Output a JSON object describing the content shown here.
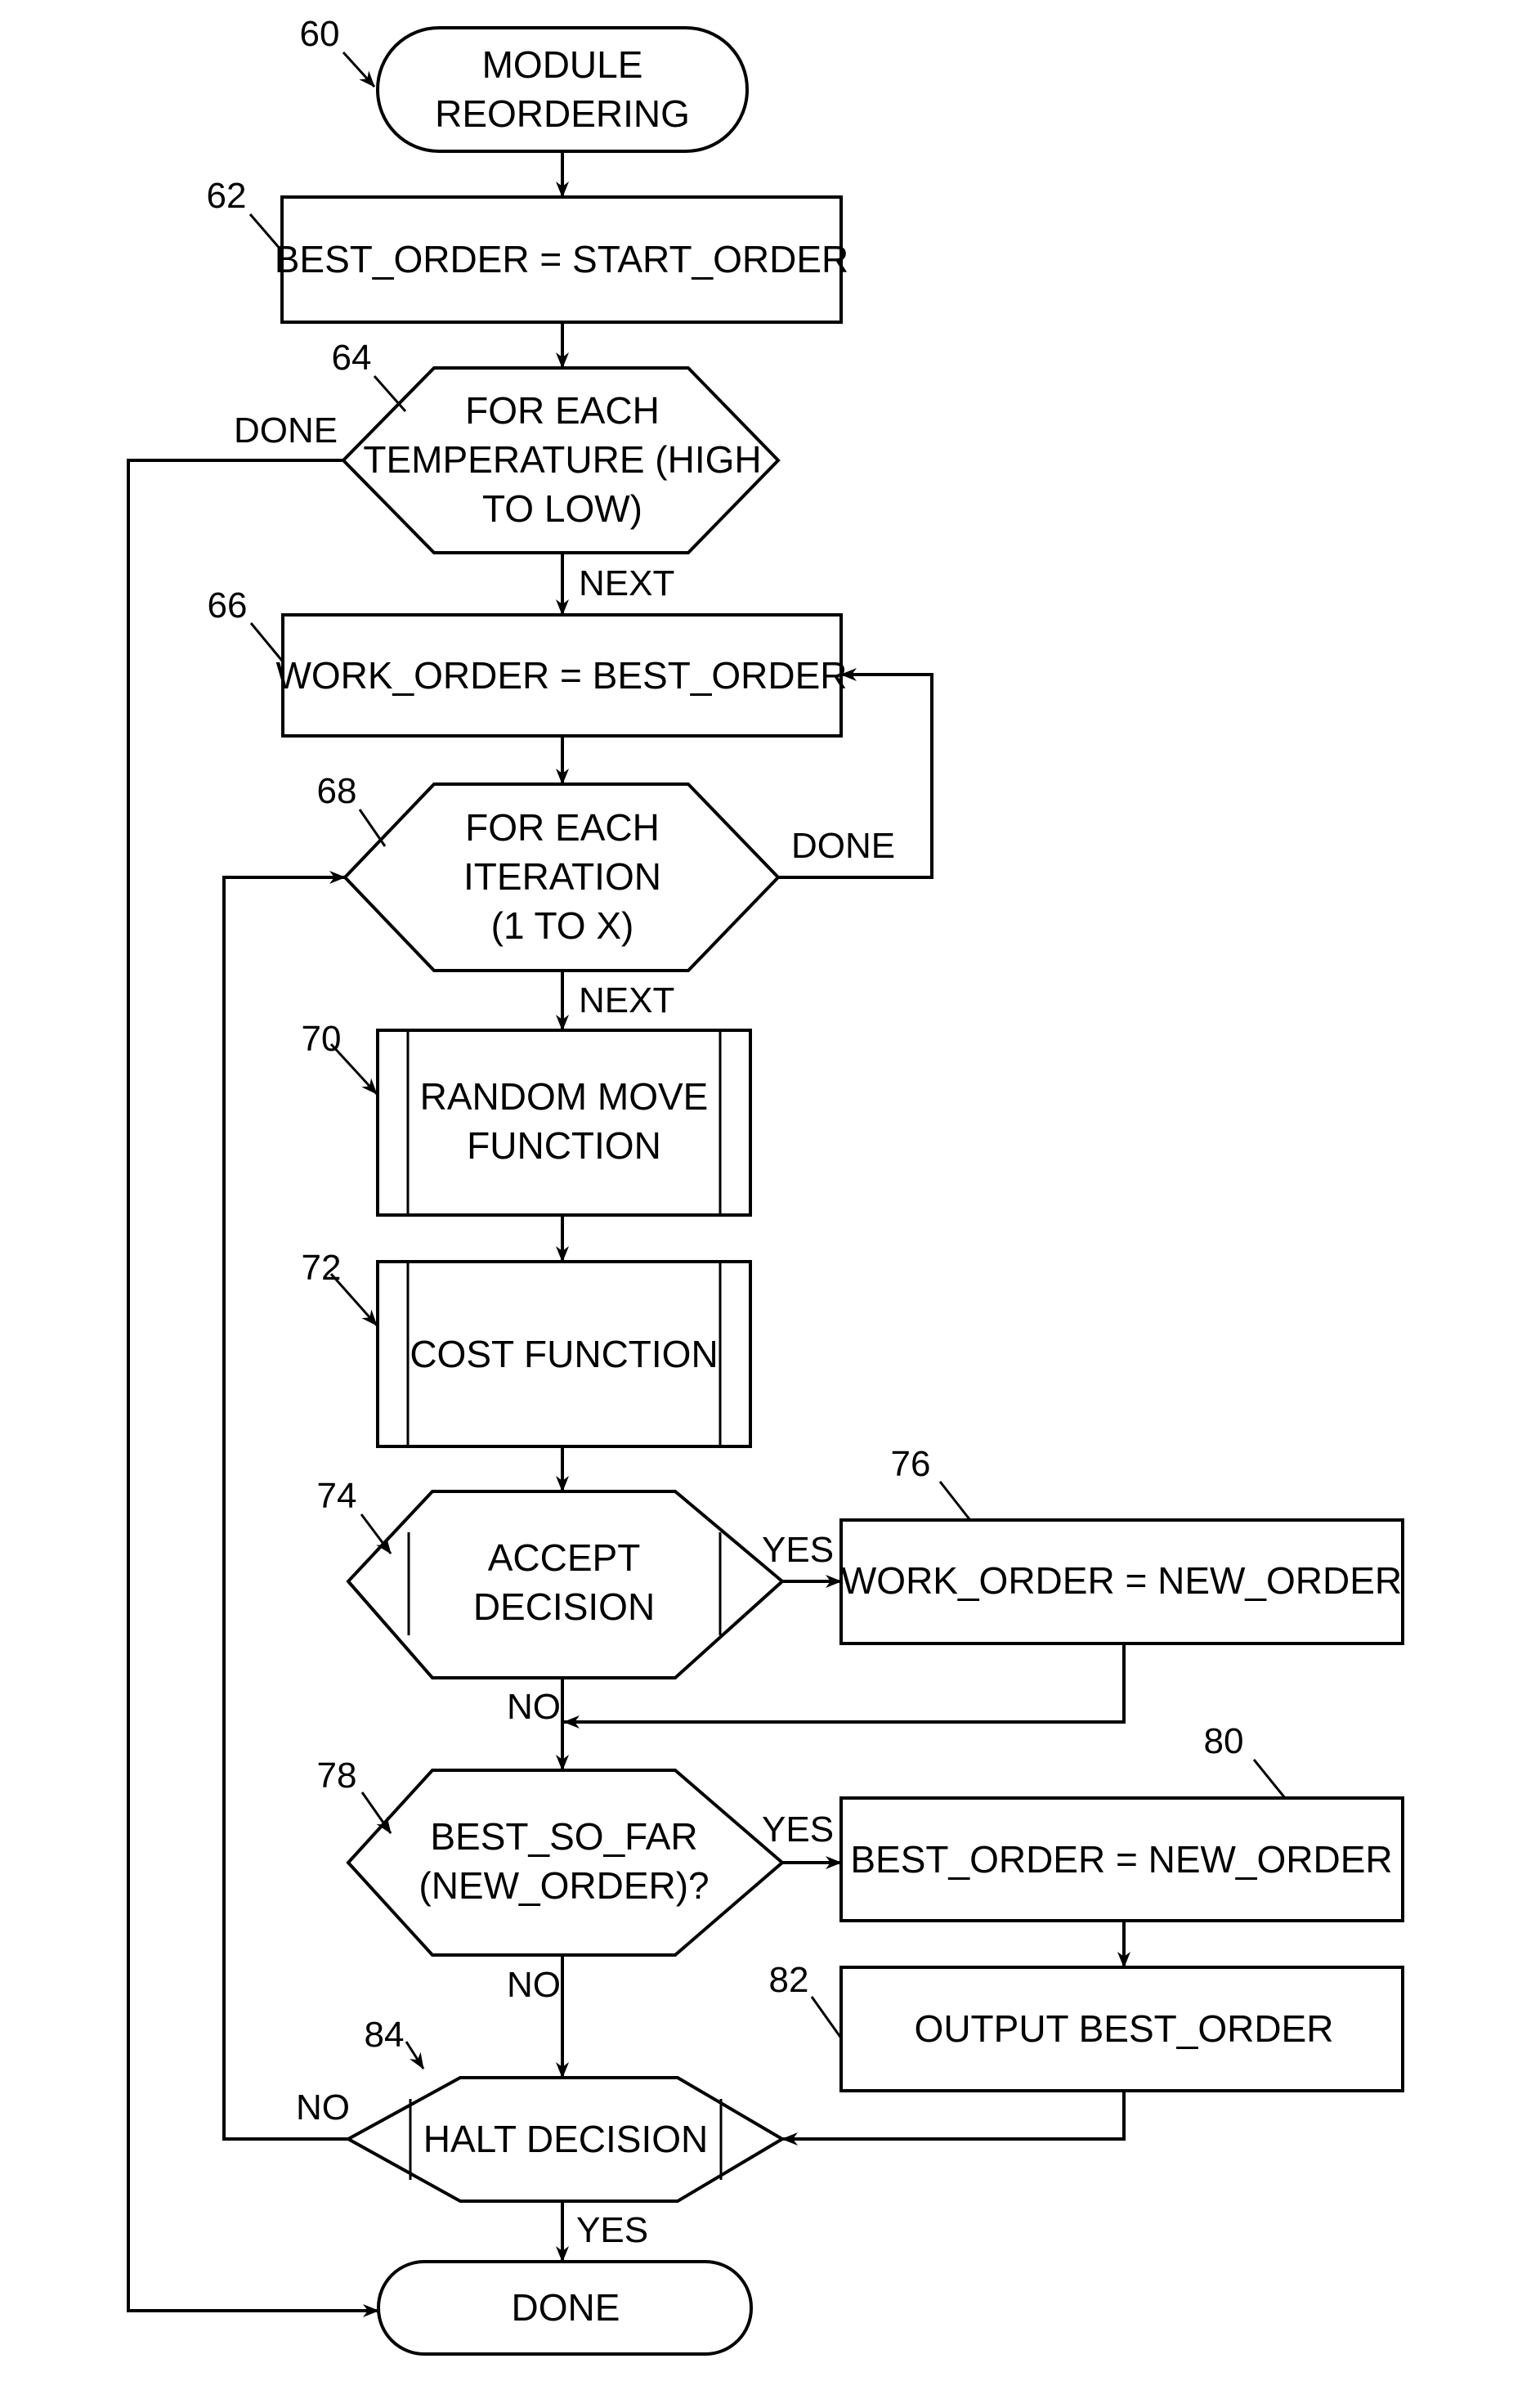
{
  "diagram": {
    "type": "flowchart",
    "colors": {
      "stroke": "#000000",
      "background": "#ffffff"
    },
    "nodes": {
      "start": {
        "ref": "60",
        "shape": "terminator",
        "lines": [
          "MODULE",
          "REORDERING"
        ]
      },
      "n62": {
        "ref": "62",
        "shape": "process",
        "lines": [
          "BEST_ORDER = START_ORDER"
        ]
      },
      "n64": {
        "ref": "64",
        "shape": "loop-hexagon",
        "lines": [
          "FOR EACH",
          "TEMPERATURE (HIGH",
          "TO LOW)"
        ]
      },
      "n66": {
        "ref": "66",
        "shape": "process",
        "lines": [
          "WORK_ORDER = BEST_ORDER"
        ]
      },
      "n68": {
        "ref": "68",
        "shape": "loop-hexagon",
        "lines": [
          "FOR EACH",
          "ITERATION",
          "(1 TO X)"
        ]
      },
      "n70": {
        "ref": "70",
        "shape": "predefined-process",
        "lines": [
          "RANDOM MOVE",
          "FUNCTION"
        ]
      },
      "n72": {
        "ref": "72",
        "shape": "predefined-process",
        "lines": [
          "COST FUNCTION"
        ]
      },
      "n74": {
        "ref": "74",
        "shape": "decision-hexagon",
        "lines": [
          "ACCEPT",
          "DECISION"
        ]
      },
      "n76": {
        "ref": "76",
        "shape": "process",
        "lines": [
          "WORK_ORDER = NEW_ORDER"
        ]
      },
      "n78": {
        "ref": "78",
        "shape": "hexagon",
        "lines": [
          "BEST_SO_FAR",
          "(NEW_ORDER)?"
        ]
      },
      "n80": {
        "ref": "80",
        "shape": "process",
        "lines": [
          "BEST_ORDER = NEW_ORDER"
        ]
      },
      "n82": {
        "ref": "82",
        "shape": "process",
        "lines": [
          "OUTPUT BEST_ORDER"
        ]
      },
      "n84": {
        "ref": "84",
        "shape": "decision-hexagon",
        "lines": [
          "HALT DECISION"
        ]
      },
      "end": {
        "shape": "terminator",
        "lines": [
          "DONE"
        ]
      }
    },
    "edge_labels": {
      "e64_done": "DONE",
      "e64_next": "NEXT",
      "e68_done": "DONE",
      "e68_next": "NEXT",
      "e74_yes": "YES",
      "e74_no": "NO",
      "e78_yes": "YES",
      "e78_no": "NO",
      "e84_no": "NO",
      "e84_yes": "YES"
    },
    "edges": [
      {
        "from": "60",
        "to": "62"
      },
      {
        "from": "62",
        "to": "64"
      },
      {
        "from": "64",
        "to": "66",
        "label": "NEXT"
      },
      {
        "from": "64",
        "to": "DONE",
        "label": "DONE"
      },
      {
        "from": "66",
        "to": "68"
      },
      {
        "from": "68",
        "to": "70",
        "label": "NEXT"
      },
      {
        "from": "68",
        "to": "66",
        "label": "DONE"
      },
      {
        "from": "70",
        "to": "72"
      },
      {
        "from": "72",
        "to": "74"
      },
      {
        "from": "74",
        "to": "76",
        "label": "YES"
      },
      {
        "from": "74",
        "to": "78",
        "label": "NO"
      },
      {
        "from": "76",
        "to": "78"
      },
      {
        "from": "78",
        "to": "80",
        "label": "YES"
      },
      {
        "from": "78",
        "to": "84",
        "label": "NO"
      },
      {
        "from": "80",
        "to": "82"
      },
      {
        "from": "82",
        "to": "84"
      },
      {
        "from": "84",
        "to": "68",
        "label": "NO"
      },
      {
        "from": "84",
        "to": "DONE",
        "label": "YES"
      }
    ]
  }
}
